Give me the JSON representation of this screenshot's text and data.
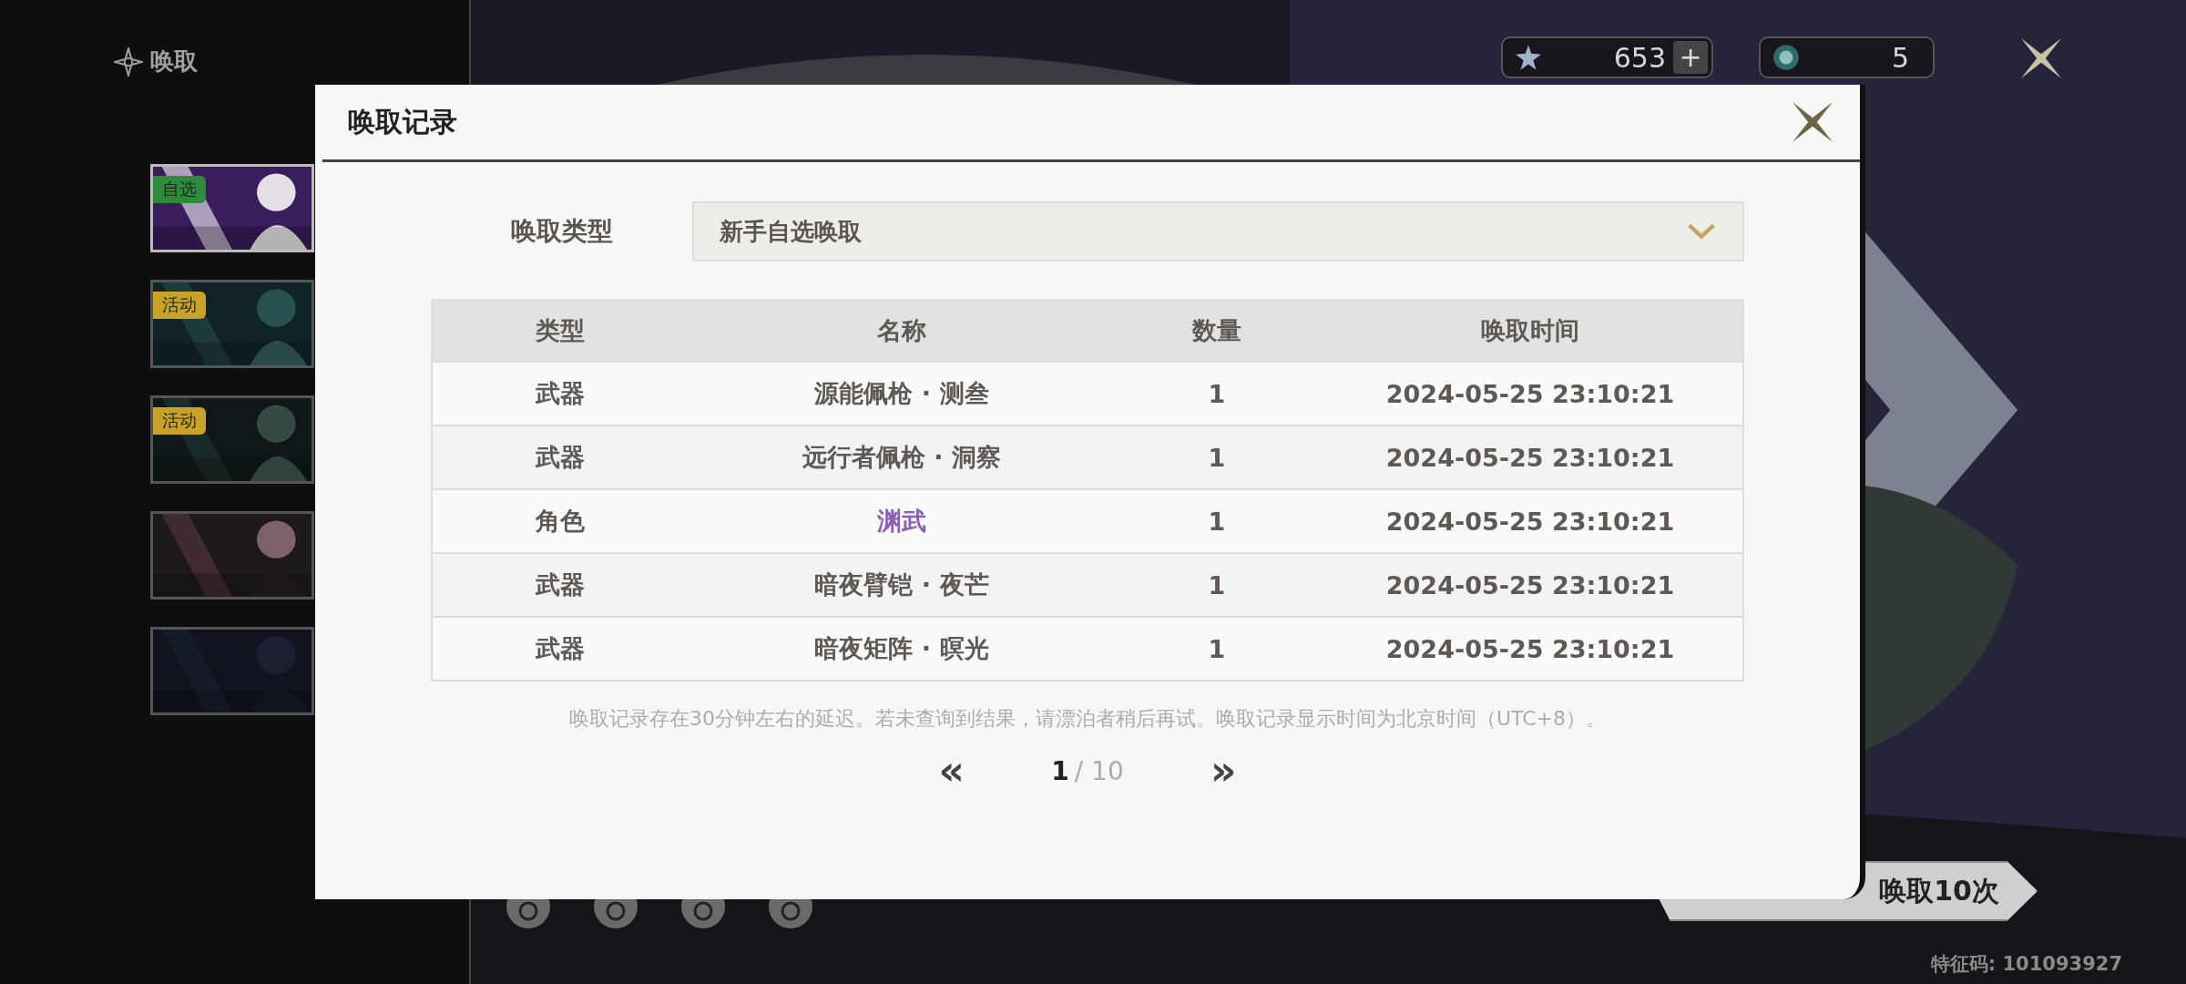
{
  "sidebar": {
    "title": "唤取",
    "banners": [
      {
        "badge": "自选",
        "color": "#2e8b3e",
        "selected": true
      },
      {
        "badge": "活动",
        "color": "#c9a227",
        "selected": false
      },
      {
        "badge": "活动",
        "color": "#c9a227",
        "selected": false
      },
      {
        "selected": false
      },
      {
        "selected": false
      }
    ]
  },
  "hud": {
    "currency_1": "653",
    "add": "+",
    "currency_2": "5"
  },
  "pull_button": {
    "label": "唤取10次"
  },
  "feature_code": "特征码: 101093927",
  "dialog": {
    "title": "唤取记录",
    "filter": {
      "label": "唤取类型",
      "value": "新手自选唤取"
    },
    "table": {
      "columns": [
        "类型",
        "名称",
        "数量",
        "唤取时间"
      ],
      "rows": [
        {
          "type": "武器",
          "name": "源能佩枪 · 测叁",
          "count": "1",
          "time": "2024-05-25 23:10:21",
          "color": "#5e5954"
        },
        {
          "type": "武器",
          "name": "远行者佩枪 · 洞察",
          "count": "1",
          "time": "2024-05-25 23:10:21",
          "color": "#5e5954"
        },
        {
          "type": "角色",
          "name": "渊武",
          "count": "1",
          "time": "2024-05-25 23:10:21",
          "color": "#8c5fb5"
        },
        {
          "type": "武器",
          "name": "暗夜臂铠 · 夜芒",
          "count": "1",
          "time": "2024-05-25 23:10:21",
          "color": "#5e5954"
        },
        {
          "type": "武器",
          "name": "暗夜矩阵 · 暝光",
          "count": "1",
          "time": "2024-05-25 23:10:21",
          "color": "#5e5954"
        }
      ]
    },
    "note": "唤取记录存在30分钟左右的延迟。若未查询到结果，请漂泊者稍后再试。唤取记录显示时间为北京时间（UTC+8）。",
    "pager": {
      "prev": "«",
      "current": "1",
      "total": "/ 10",
      "next": "»"
    }
  }
}
